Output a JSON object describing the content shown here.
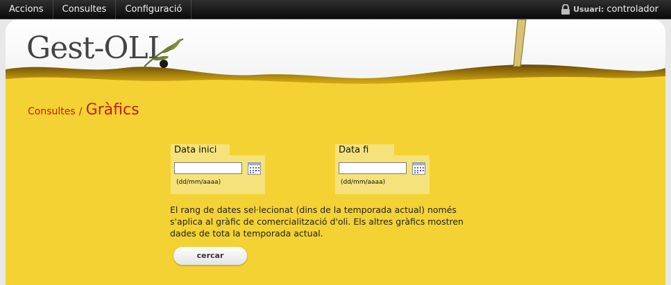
{
  "nav": {
    "items": [
      "Accions",
      "Consultes",
      "Configuració"
    ],
    "user_label": "Usuari:",
    "user_name": "controlador"
  },
  "logo": {
    "text": "Gest-OLI"
  },
  "breadcrumb": {
    "parent": "Consultes",
    "separator": "/",
    "current": "Gràfics"
  },
  "form": {
    "start": {
      "label": "Data inici",
      "value": "",
      "hint": "(dd/mm/aaaa)"
    },
    "end": {
      "label": "Data fi",
      "value": "",
      "hint": "(dd/mm/aaaa)"
    },
    "info_text": "El rang de dates sel·lecionat (dins de la temporada actual) només s'aplica al gràfic de comercialització d'oli. Els altres gràfics mostren dades de tota la temporada actual.",
    "search_label": "cercar"
  },
  "colors": {
    "accent": "#c21d12",
    "oil": "#f4d233",
    "topbar": "#111111"
  }
}
